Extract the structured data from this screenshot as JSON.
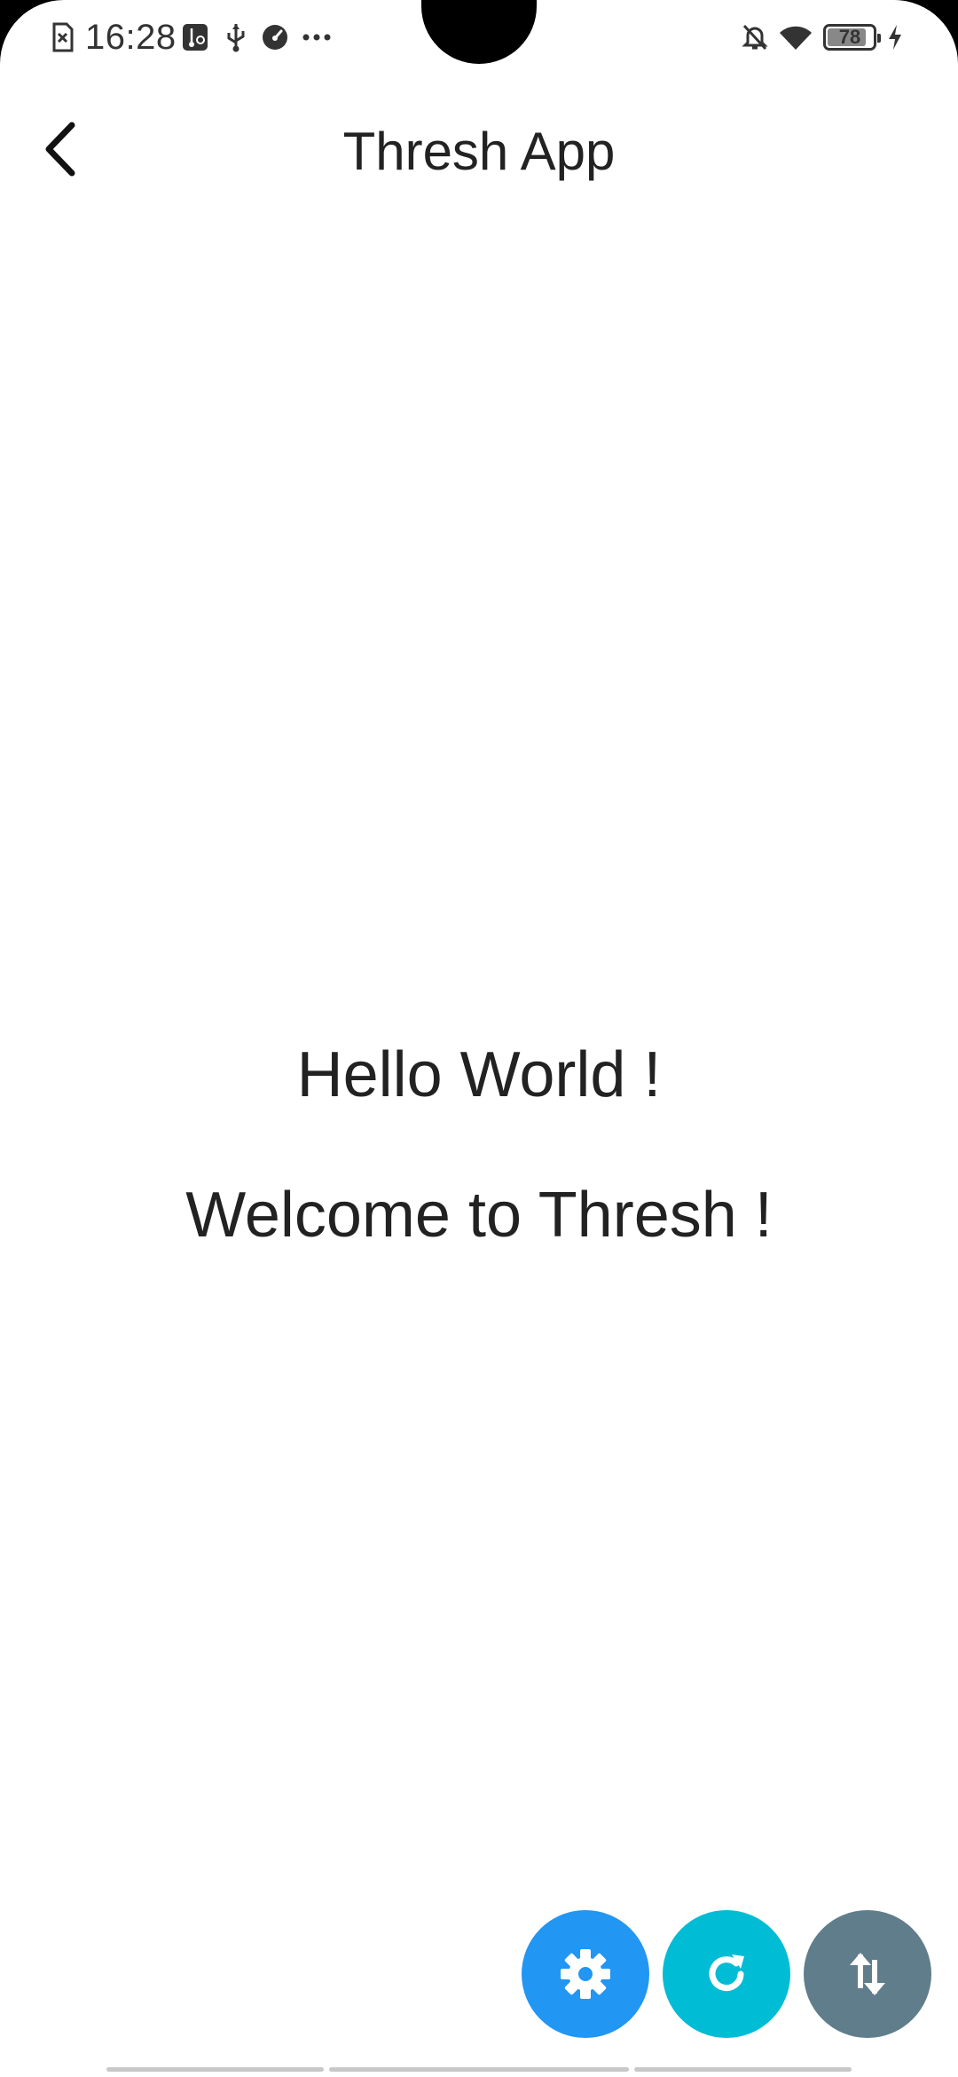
{
  "status_bar": {
    "time": "16:28",
    "battery_level": "78",
    "icons": [
      "sim-error-icon",
      "usb-settings-icon",
      "usb-icon",
      "speedometer-icon",
      "more-dots-icon",
      "notifications-off-icon",
      "wifi-icon",
      "battery-icon",
      "charging-icon"
    ]
  },
  "app_bar": {
    "title": "Thresh App",
    "back_icon": "back-arrow-icon"
  },
  "content": {
    "line1": "Hello World !",
    "line2": "Welcome to Thresh !"
  },
  "fabs": [
    {
      "name": "settings",
      "icon": "gear-icon",
      "color": "#2196F3"
    },
    {
      "name": "refresh",
      "icon": "refresh-icon",
      "color": "#00BCD4"
    },
    {
      "name": "swap",
      "icon": "swap-vertical-icon",
      "color": "#607D8B"
    }
  ],
  "colors": {
    "background": "#FFFFFF",
    "text": "#222222"
  }
}
